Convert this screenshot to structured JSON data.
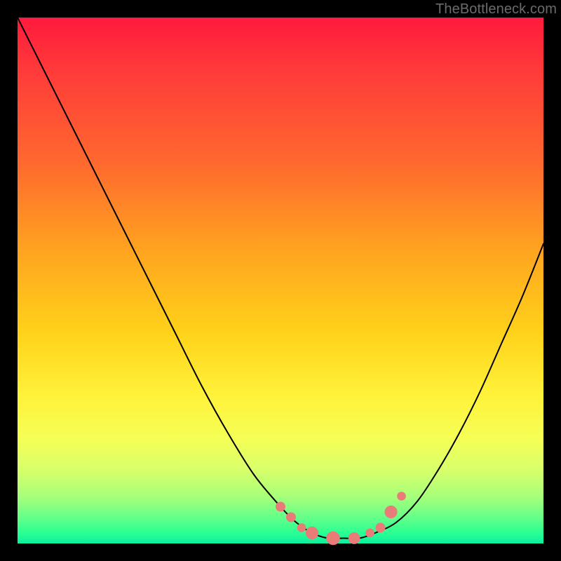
{
  "watermark": "TheBottleneck.com",
  "chart_data": {
    "type": "line",
    "title": "",
    "xlabel": "",
    "ylabel": "",
    "xlim": [
      0,
      100
    ],
    "ylim": [
      0,
      100
    ],
    "grid": false,
    "series": [
      {
        "name": "bottleneck-curve",
        "x": [
          0,
          5,
          10,
          15,
          20,
          25,
          30,
          35,
          40,
          45,
          50,
          53,
          56,
          59,
          62,
          65,
          68,
          72,
          76,
          80,
          84,
          88,
          92,
          96,
          100
        ],
        "values": [
          100,
          90,
          80,
          70,
          60,
          50,
          40,
          30,
          21,
          13,
          7,
          4,
          2,
          1,
          1,
          1,
          2,
          4,
          8,
          14,
          21,
          29,
          38,
          47,
          57
        ]
      }
    ],
    "markers": {
      "name": "bottom-dots",
      "color": "#e97b78",
      "points": [
        {
          "x": 50,
          "y": 7,
          "r": 1.0
        },
        {
          "x": 52,
          "y": 5,
          "r": 1.0
        },
        {
          "x": 54,
          "y": 3,
          "r": 0.9
        },
        {
          "x": 56,
          "y": 2,
          "r": 1.3
        },
        {
          "x": 60,
          "y": 1,
          "r": 1.4
        },
        {
          "x": 64,
          "y": 1,
          "r": 1.2
        },
        {
          "x": 67,
          "y": 2,
          "r": 0.9
        },
        {
          "x": 69,
          "y": 3,
          "r": 1.0
        },
        {
          "x": 71,
          "y": 6,
          "r": 1.3
        },
        {
          "x": 73,
          "y": 9,
          "r": 0.9
        }
      ]
    },
    "background_gradient": {
      "top": "#ff1a3c",
      "upper_mid": "#ffa61f",
      "mid": "#fff23a",
      "lower": "#66ff88",
      "bottom": "#0cf0a0"
    }
  }
}
